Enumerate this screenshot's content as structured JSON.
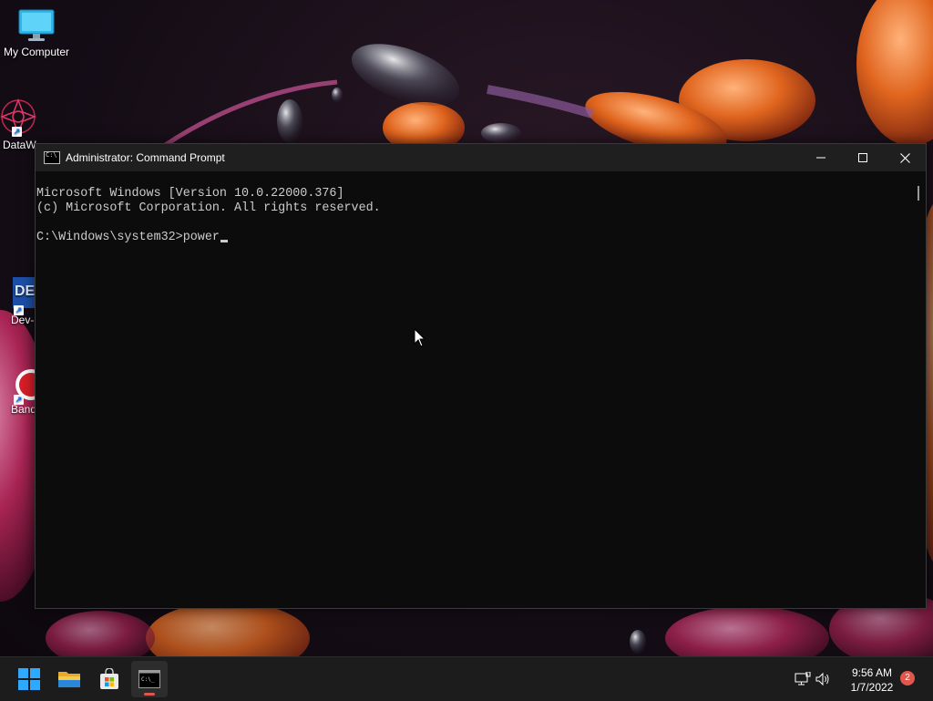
{
  "desktop": {
    "icons": [
      {
        "label": "My Computer",
        "icon": "monitor-icon"
      },
      {
        "label": "DataW",
        "icon": "datawrapper-icon"
      },
      {
        "label": "Dev-",
        "icon": "dev-cpp-icon"
      },
      {
        "label": "Band",
        "icon": "bandicam-icon"
      }
    ]
  },
  "window": {
    "title": "Administrator: Command Prompt",
    "controls": [
      "minimize-icon",
      "maximize-icon",
      "close-icon"
    ],
    "console_lines": [
      "Microsoft Windows [Version 10.0.22000.376]",
      "(c) Microsoft Corporation. All rights reserved.",
      "",
      "C:\\Windows\\system32>power"
    ]
  },
  "taskbar": {
    "apps": [
      {
        "name": "start",
        "icon": "windows-logo-icon"
      },
      {
        "name": "file-explorer",
        "icon": "folder-icon"
      },
      {
        "name": "microsoft-store",
        "icon": "store-icon"
      },
      {
        "name": "command-prompt",
        "icon": "terminal-icon",
        "active": true
      }
    ],
    "tray": {
      "time": "9:56 AM",
      "date": "1/7/2022",
      "notifications": "2"
    }
  },
  "colors": {
    "console_bg": "#0c0c0c",
    "console_text": "#cccccc",
    "titlebar": "#1f1f1f",
    "taskbar": "#1c1c1c",
    "accent": "#e2574c"
  }
}
